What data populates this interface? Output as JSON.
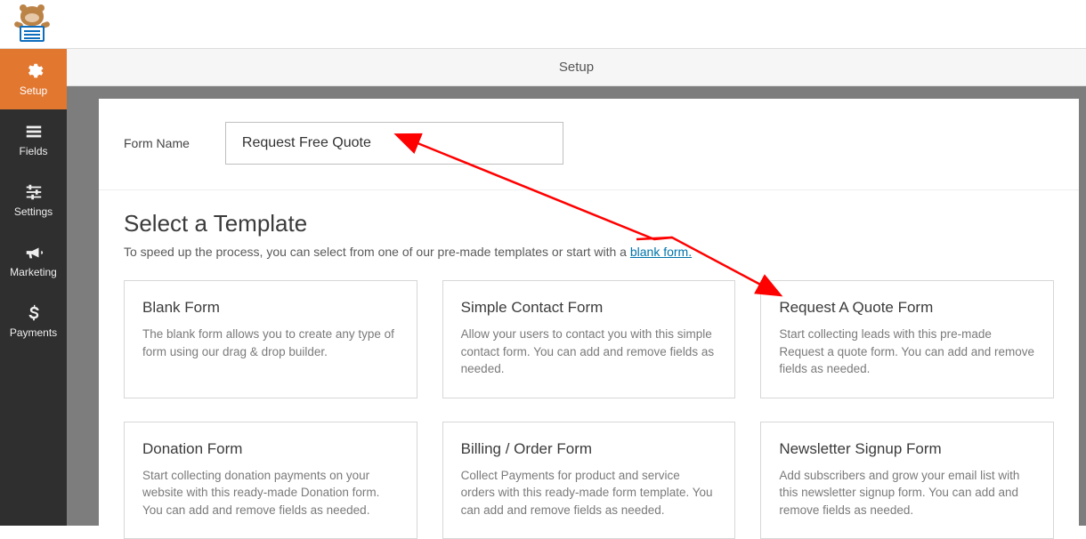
{
  "header": {
    "title": "Setup"
  },
  "sidebar": {
    "items": [
      {
        "label": "Setup",
        "active": true
      },
      {
        "label": "Fields"
      },
      {
        "label": "Settings"
      },
      {
        "label": "Marketing"
      },
      {
        "label": "Payments"
      }
    ]
  },
  "form_name": {
    "label": "Form Name",
    "value": "Request Free Quote"
  },
  "templates": {
    "heading": "Select a Template",
    "intro_pre": "To speed up the process, you can select from one of our pre-made templates or start with a ",
    "intro_link": "blank form.",
    "cards": [
      {
        "title": "Blank Form",
        "desc": "The blank form allows you to create any type of form using our drag & drop builder."
      },
      {
        "title": "Simple Contact Form",
        "desc": "Allow your users to contact you with this simple contact form. You can add and remove fields as needed."
      },
      {
        "title": "Request A Quote Form",
        "desc": "Start collecting leads with this pre-made Request a quote form. You can add and remove fields as needed."
      },
      {
        "title": "Donation Form",
        "desc": "Start collecting donation payments on your website with this ready-made Donation form. You can add and remove fields as needed."
      },
      {
        "title": "Billing / Order Form",
        "desc": "Collect Payments for product and service orders with this ready-made form template. You can add and remove fields as needed."
      },
      {
        "title": "Newsletter Signup Form",
        "desc": "Add subscribers and grow your email list with this newsletter signup form. You can add and remove fields as needed."
      }
    ]
  }
}
